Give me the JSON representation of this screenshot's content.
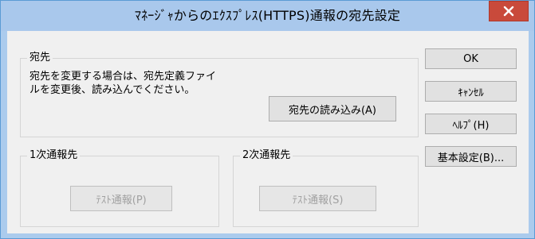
{
  "window": {
    "title": "ﾏﾈｰｼﾞｬからのｴｸｽﾌﾟﾚｽ(HTTPS)通報の宛先設定",
    "close_glyph": "x",
    "accent": "#5b9bd5",
    "close_color": "#c94a3b"
  },
  "destination_group": {
    "label": "宛先",
    "description_line1": "宛先を変更する場合は、宛先定義ファイ",
    "description_line2": "ルを変更後、読み込んでください。",
    "load_button": "宛先の読み込み(A)"
  },
  "primary_group": {
    "label": "1次通報先",
    "test_button": "ﾃｽﾄ通報(P)"
  },
  "secondary_group": {
    "label": "2次通報先",
    "test_button": "ﾃｽﾄ通報(S)"
  },
  "side_buttons": {
    "ok": "OK",
    "cancel": "ｷｬﾝｾﾙ",
    "help": "ﾍﾙﾌﾟ(H)",
    "basic_settings": "基本設定(B)..."
  }
}
